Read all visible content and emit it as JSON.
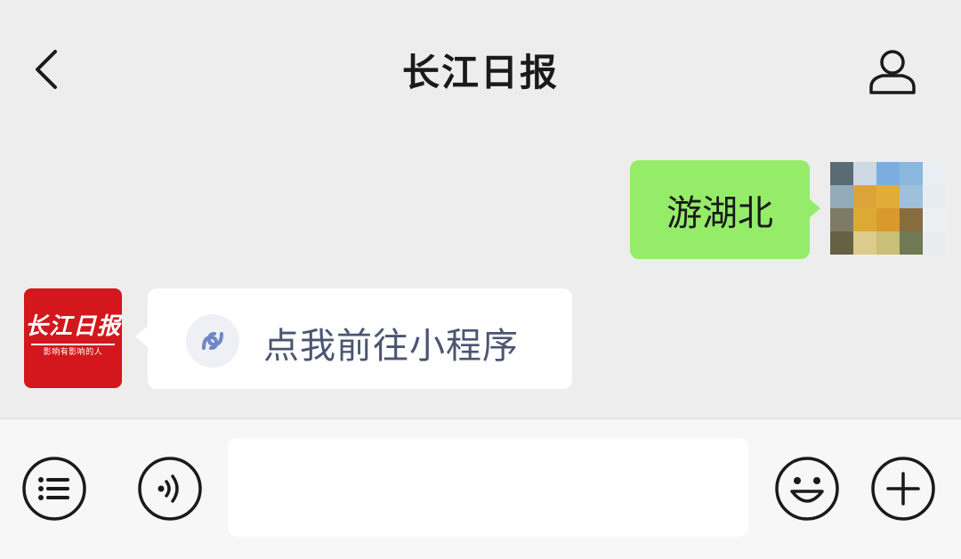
{
  "header": {
    "title": "长江日报",
    "back_icon": "chevron-left-icon",
    "profile_icon": "user-profile-icon"
  },
  "messages": [
    {
      "direction": "out",
      "text": "游湖北",
      "bubble_color": "#95ec69"
    },
    {
      "direction": "in",
      "type": "mini-program-link",
      "text": "点我前往小程序",
      "icon": "link-icon",
      "text_color": "#4b5571"
    }
  ],
  "bot_avatar": {
    "logo_text": "长江日报",
    "slogan": "影响有影响的人",
    "brand_color": "#d3171c"
  },
  "input_bar": {
    "menu_icon": "list-menu-icon",
    "voice_icon": "voice-icon",
    "input_value": "",
    "emoji_icon": "smiley-icon",
    "plus_icon": "plus-icon"
  }
}
